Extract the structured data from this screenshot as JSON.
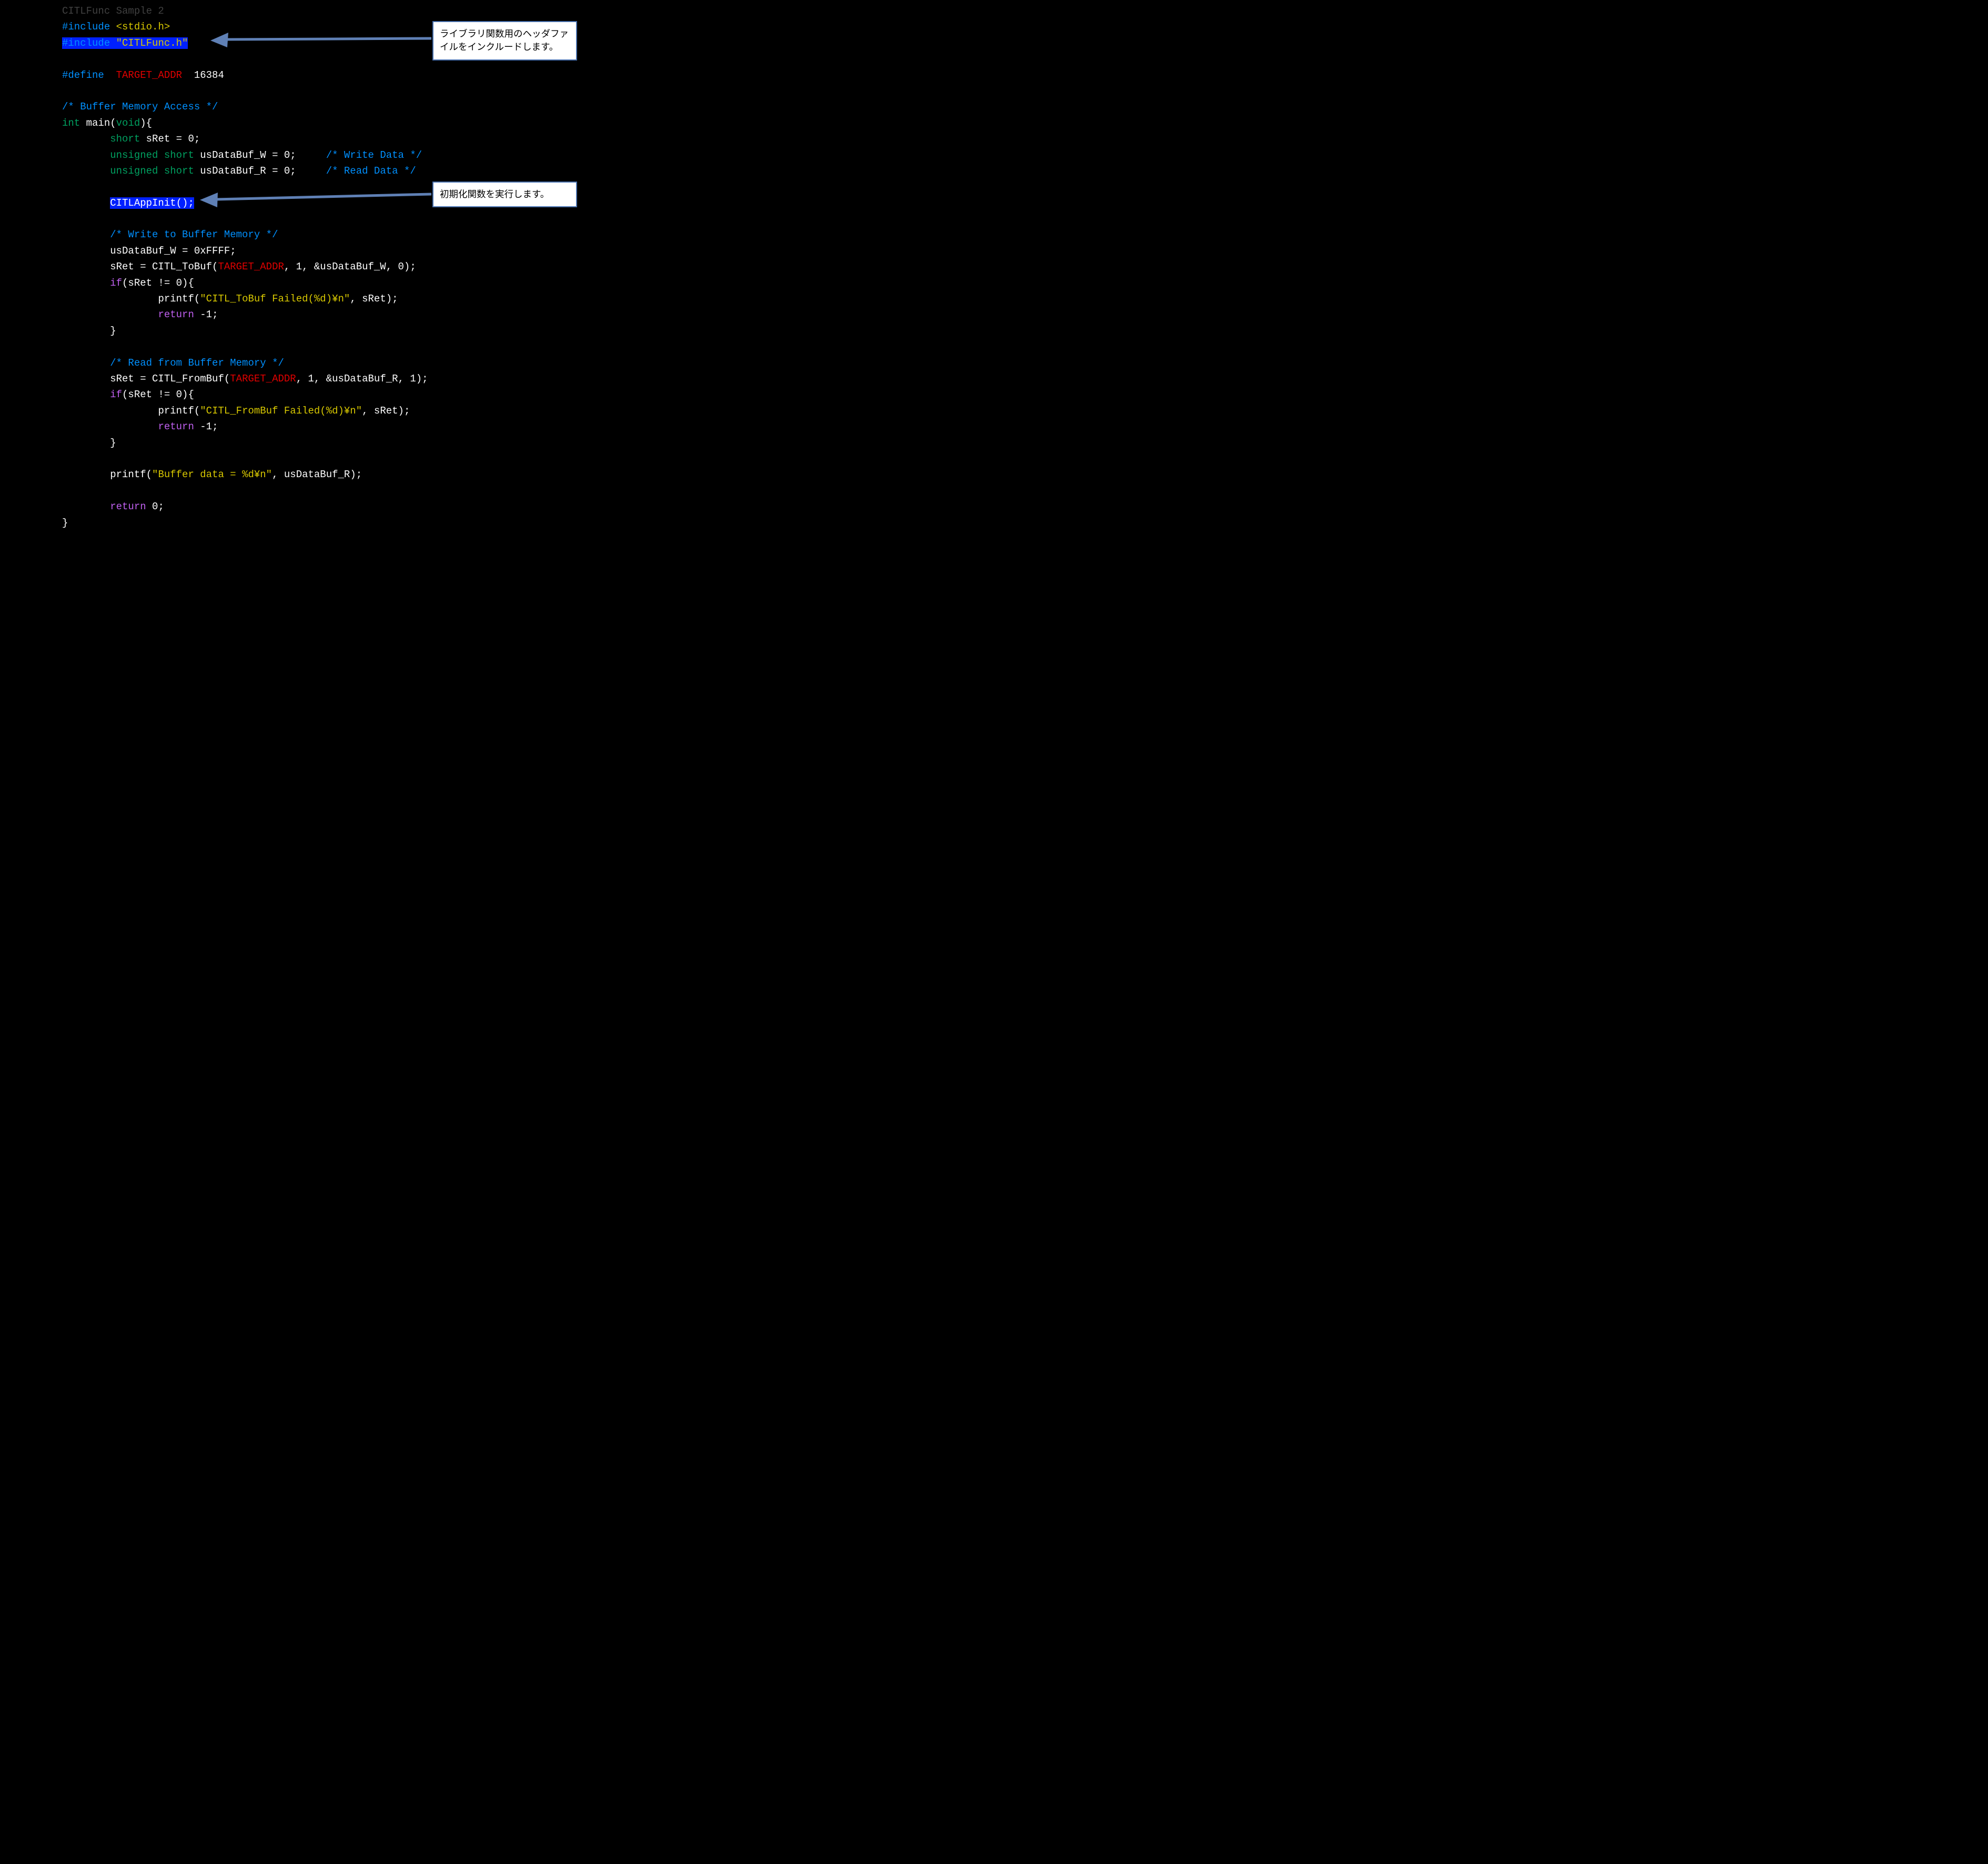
{
  "code": {
    "title": "CITLFunc Sample 2",
    "include1_pre": "#include ",
    "include1_hdr": "<stdio.h>",
    "include2_pre": "#include ",
    "include2_hdr": "\"CITLFunc.h\"",
    "define_pre": "#define  ",
    "define_name": "TARGET_ADDR",
    "define_val": "  16384",
    "cmt_bma": "/* Buffer Memory Access */",
    "kw_int": "int",
    "main_name": " main(",
    "kw_void": "void",
    "main_tail": "){",
    "kw_short": "short",
    "decl_sret": " sRet = 0;",
    "kw_unsigned": "unsigned",
    "sp": " ",
    "decl_w": " usDataBuf_W = 0;     ",
    "cmt_w": "/* Write Data */",
    "decl_r": " usDataBuf_R = 0;     ",
    "cmt_r": "/* Read Data */",
    "call_init": "CITLAppInit();",
    "cmt_write": "/* Write to Buffer Memory */",
    "assign_w": "usDataBuf_W = 0xFFFF;",
    "tobuf_a": "sRet = CITL_ToBuf(",
    "tobuf_b": ", 1, &usDataBuf_W, 0);",
    "if_hdr": "if",
    "if_cond": "(sRet != 0){",
    "printf_tobuf_a": "printf(",
    "printf_tobuf_str": "\"CITL_ToBuf Failed(%d)¥n\"",
    "printf_tobuf_b": ", sRet);",
    "kw_return": "return",
    "ret_m1": " -1;",
    "brace_close": "}",
    "cmt_read": "/* Read from Buffer Memory */",
    "frombuf_a": "sRet = CITL_FromBuf(",
    "frombuf_b": ", 1, &usDataBuf_R, 1);",
    "printf_frombuf_str": "\"CITL_FromBuf Failed(%d)¥n\"",
    "printf_last_a": "printf(",
    "printf_last_str": "\"Buffer data = %d¥n\"",
    "printf_last_b": ", usDataBuf_R);",
    "ret_0": " 0;"
  },
  "callouts": {
    "top": "ライブラリ関数用のヘッダファイルをインクルードします。",
    "mid": "初期化関数を実行します。"
  }
}
